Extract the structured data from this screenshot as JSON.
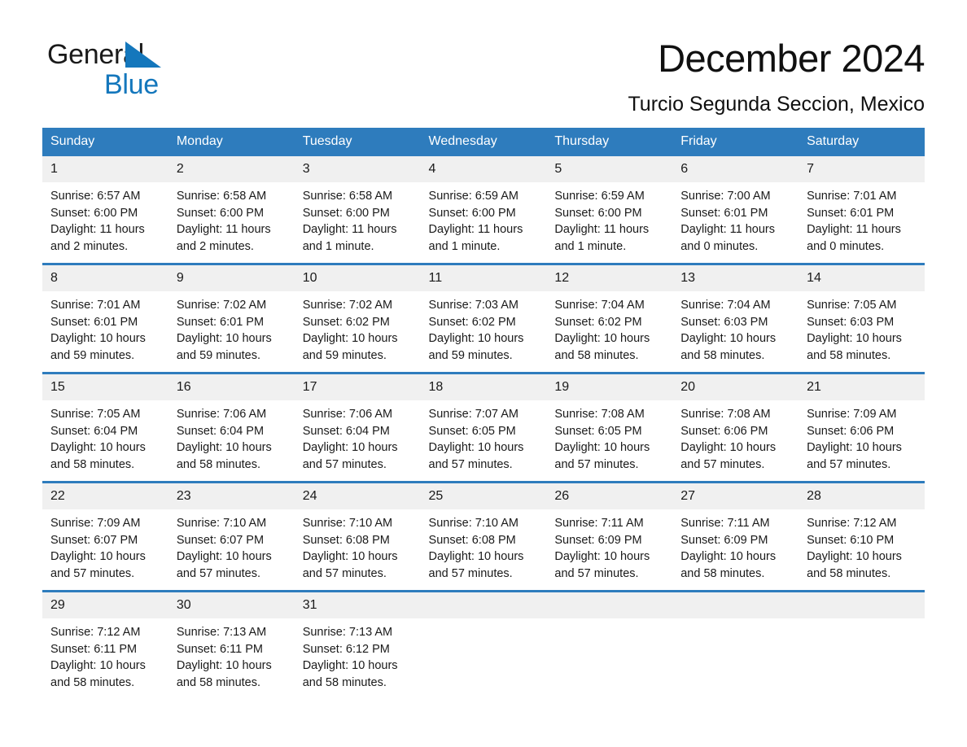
{
  "brand": {
    "name_top": "General",
    "name_bottom": "Blue",
    "triangle_color": "#1477bc",
    "accent_color": "#2e7cbd"
  },
  "header": {
    "month_title": "December 2024",
    "location": "Turcio Segunda Seccion, Mexico"
  },
  "calendar": {
    "weekday_headers": [
      "Sunday",
      "Monday",
      "Tuesday",
      "Wednesday",
      "Thursday",
      "Friday",
      "Saturday"
    ],
    "weeks": [
      [
        {
          "day": "1",
          "sunrise": "Sunrise: 6:57 AM",
          "sunset": "Sunset: 6:00 PM",
          "daylight_line1": "Daylight: 11 hours",
          "daylight_line2": "and 2 minutes."
        },
        {
          "day": "2",
          "sunrise": "Sunrise: 6:58 AM",
          "sunset": "Sunset: 6:00 PM",
          "daylight_line1": "Daylight: 11 hours",
          "daylight_line2": "and 2 minutes."
        },
        {
          "day": "3",
          "sunrise": "Sunrise: 6:58 AM",
          "sunset": "Sunset: 6:00 PM",
          "daylight_line1": "Daylight: 11 hours",
          "daylight_line2": "and 1 minute."
        },
        {
          "day": "4",
          "sunrise": "Sunrise: 6:59 AM",
          "sunset": "Sunset: 6:00 PM",
          "daylight_line1": "Daylight: 11 hours",
          "daylight_line2": "and 1 minute."
        },
        {
          "day": "5",
          "sunrise": "Sunrise: 6:59 AM",
          "sunset": "Sunset: 6:00 PM",
          "daylight_line1": "Daylight: 11 hours",
          "daylight_line2": "and 1 minute."
        },
        {
          "day": "6",
          "sunrise": "Sunrise: 7:00 AM",
          "sunset": "Sunset: 6:01 PM",
          "daylight_line1": "Daylight: 11 hours",
          "daylight_line2": "and 0 minutes."
        },
        {
          "day": "7",
          "sunrise": "Sunrise: 7:01 AM",
          "sunset": "Sunset: 6:01 PM",
          "daylight_line1": "Daylight: 11 hours",
          "daylight_line2": "and 0 minutes."
        }
      ],
      [
        {
          "day": "8",
          "sunrise": "Sunrise: 7:01 AM",
          "sunset": "Sunset: 6:01 PM",
          "daylight_line1": "Daylight: 10 hours",
          "daylight_line2": "and 59 minutes."
        },
        {
          "day": "9",
          "sunrise": "Sunrise: 7:02 AM",
          "sunset": "Sunset: 6:01 PM",
          "daylight_line1": "Daylight: 10 hours",
          "daylight_line2": "and 59 minutes."
        },
        {
          "day": "10",
          "sunrise": "Sunrise: 7:02 AM",
          "sunset": "Sunset: 6:02 PM",
          "daylight_line1": "Daylight: 10 hours",
          "daylight_line2": "and 59 minutes."
        },
        {
          "day": "11",
          "sunrise": "Sunrise: 7:03 AM",
          "sunset": "Sunset: 6:02 PM",
          "daylight_line1": "Daylight: 10 hours",
          "daylight_line2": "and 59 minutes."
        },
        {
          "day": "12",
          "sunrise": "Sunrise: 7:04 AM",
          "sunset": "Sunset: 6:02 PM",
          "daylight_line1": "Daylight: 10 hours",
          "daylight_line2": "and 58 minutes."
        },
        {
          "day": "13",
          "sunrise": "Sunrise: 7:04 AM",
          "sunset": "Sunset: 6:03 PM",
          "daylight_line1": "Daylight: 10 hours",
          "daylight_line2": "and 58 minutes."
        },
        {
          "day": "14",
          "sunrise": "Sunrise: 7:05 AM",
          "sunset": "Sunset: 6:03 PM",
          "daylight_line1": "Daylight: 10 hours",
          "daylight_line2": "and 58 minutes."
        }
      ],
      [
        {
          "day": "15",
          "sunrise": "Sunrise: 7:05 AM",
          "sunset": "Sunset: 6:04 PM",
          "daylight_line1": "Daylight: 10 hours",
          "daylight_line2": "and 58 minutes."
        },
        {
          "day": "16",
          "sunrise": "Sunrise: 7:06 AM",
          "sunset": "Sunset: 6:04 PM",
          "daylight_line1": "Daylight: 10 hours",
          "daylight_line2": "and 58 minutes."
        },
        {
          "day": "17",
          "sunrise": "Sunrise: 7:06 AM",
          "sunset": "Sunset: 6:04 PM",
          "daylight_line1": "Daylight: 10 hours",
          "daylight_line2": "and 57 minutes."
        },
        {
          "day": "18",
          "sunrise": "Sunrise: 7:07 AM",
          "sunset": "Sunset: 6:05 PM",
          "daylight_line1": "Daylight: 10 hours",
          "daylight_line2": "and 57 minutes."
        },
        {
          "day": "19",
          "sunrise": "Sunrise: 7:08 AM",
          "sunset": "Sunset: 6:05 PM",
          "daylight_line1": "Daylight: 10 hours",
          "daylight_line2": "and 57 minutes."
        },
        {
          "day": "20",
          "sunrise": "Sunrise: 7:08 AM",
          "sunset": "Sunset: 6:06 PM",
          "daylight_line1": "Daylight: 10 hours",
          "daylight_line2": "and 57 minutes."
        },
        {
          "day": "21",
          "sunrise": "Sunrise: 7:09 AM",
          "sunset": "Sunset: 6:06 PM",
          "daylight_line1": "Daylight: 10 hours",
          "daylight_line2": "and 57 minutes."
        }
      ],
      [
        {
          "day": "22",
          "sunrise": "Sunrise: 7:09 AM",
          "sunset": "Sunset: 6:07 PM",
          "daylight_line1": "Daylight: 10 hours",
          "daylight_line2": "and 57 minutes."
        },
        {
          "day": "23",
          "sunrise": "Sunrise: 7:10 AM",
          "sunset": "Sunset: 6:07 PM",
          "daylight_line1": "Daylight: 10 hours",
          "daylight_line2": "and 57 minutes."
        },
        {
          "day": "24",
          "sunrise": "Sunrise: 7:10 AM",
          "sunset": "Sunset: 6:08 PM",
          "daylight_line1": "Daylight: 10 hours",
          "daylight_line2": "and 57 minutes."
        },
        {
          "day": "25",
          "sunrise": "Sunrise: 7:10 AM",
          "sunset": "Sunset: 6:08 PM",
          "daylight_line1": "Daylight: 10 hours",
          "daylight_line2": "and 57 minutes."
        },
        {
          "day": "26",
          "sunrise": "Sunrise: 7:11 AM",
          "sunset": "Sunset: 6:09 PM",
          "daylight_line1": "Daylight: 10 hours",
          "daylight_line2": "and 57 minutes."
        },
        {
          "day": "27",
          "sunrise": "Sunrise: 7:11 AM",
          "sunset": "Sunset: 6:09 PM",
          "daylight_line1": "Daylight: 10 hours",
          "daylight_line2": "and 58 minutes."
        },
        {
          "day": "28",
          "sunrise": "Sunrise: 7:12 AM",
          "sunset": "Sunset: 6:10 PM",
          "daylight_line1": "Daylight: 10 hours",
          "daylight_line2": "and 58 minutes."
        }
      ],
      [
        {
          "day": "29",
          "sunrise": "Sunrise: 7:12 AM",
          "sunset": "Sunset: 6:11 PM",
          "daylight_line1": "Daylight: 10 hours",
          "daylight_line2": "and 58 minutes."
        },
        {
          "day": "30",
          "sunrise": "Sunrise: 7:13 AM",
          "sunset": "Sunset: 6:11 PM",
          "daylight_line1": "Daylight: 10 hours",
          "daylight_line2": "and 58 minutes."
        },
        {
          "day": "31",
          "sunrise": "Sunrise: 7:13 AM",
          "sunset": "Sunset: 6:12 PM",
          "daylight_line1": "Daylight: 10 hours",
          "daylight_line2": "and 58 minutes."
        },
        {
          "day": "",
          "sunrise": "",
          "sunset": "",
          "daylight_line1": "",
          "daylight_line2": ""
        },
        {
          "day": "",
          "sunrise": "",
          "sunset": "",
          "daylight_line1": "",
          "daylight_line2": ""
        },
        {
          "day": "",
          "sunrise": "",
          "sunset": "",
          "daylight_line1": "",
          "daylight_line2": ""
        },
        {
          "day": "",
          "sunrise": "",
          "sunset": "",
          "daylight_line1": "",
          "daylight_line2": ""
        }
      ]
    ]
  }
}
